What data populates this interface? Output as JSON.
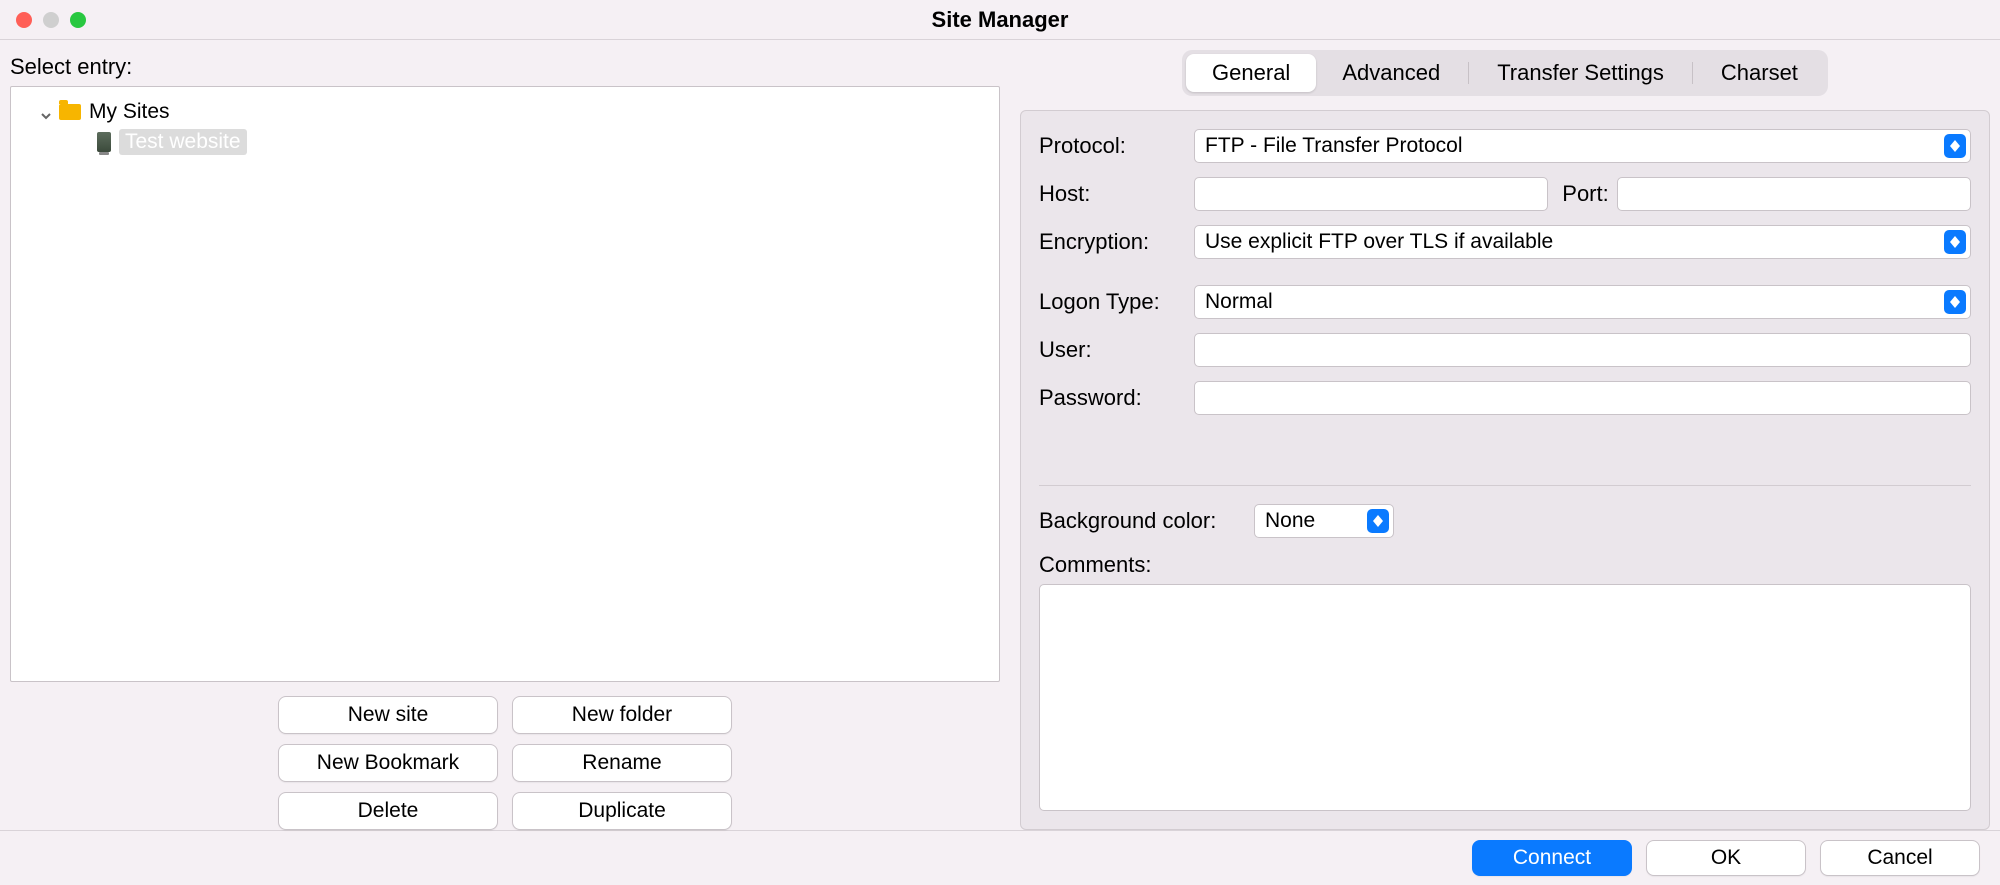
{
  "window": {
    "title": "Site Manager"
  },
  "left": {
    "select_entry_label": "Select entry:",
    "tree": {
      "root": {
        "label": "My Sites"
      },
      "items": [
        {
          "label": "Test website"
        }
      ]
    },
    "buttons": {
      "new_site": "New site",
      "new_folder": "New folder",
      "new_bookmark": "New Bookmark",
      "rename": "Rename",
      "delete": "Delete",
      "duplicate": "Duplicate"
    }
  },
  "tabs": {
    "general": "General",
    "advanced": "Advanced",
    "transfer_settings": "Transfer Settings",
    "charset": "Charset"
  },
  "form": {
    "protocol_label": "Protocol:",
    "protocol_value": "FTP - File Transfer Protocol",
    "host_label": "Host:",
    "host_value": "",
    "port_label": "Port:",
    "port_value": "",
    "encryption_label": "Encryption:",
    "encryption_value": "Use explicit FTP over TLS if available",
    "logon_type_label": "Logon Type:",
    "logon_type_value": "Normal",
    "user_label": "User:",
    "user_value": "",
    "password_label": "Password:",
    "password_value": "",
    "bg_color_label": "Background color:",
    "bg_color_value": "None",
    "comments_label": "Comments:",
    "comments_value": ""
  },
  "footer": {
    "connect": "Connect",
    "ok": "OK",
    "cancel": "Cancel"
  }
}
